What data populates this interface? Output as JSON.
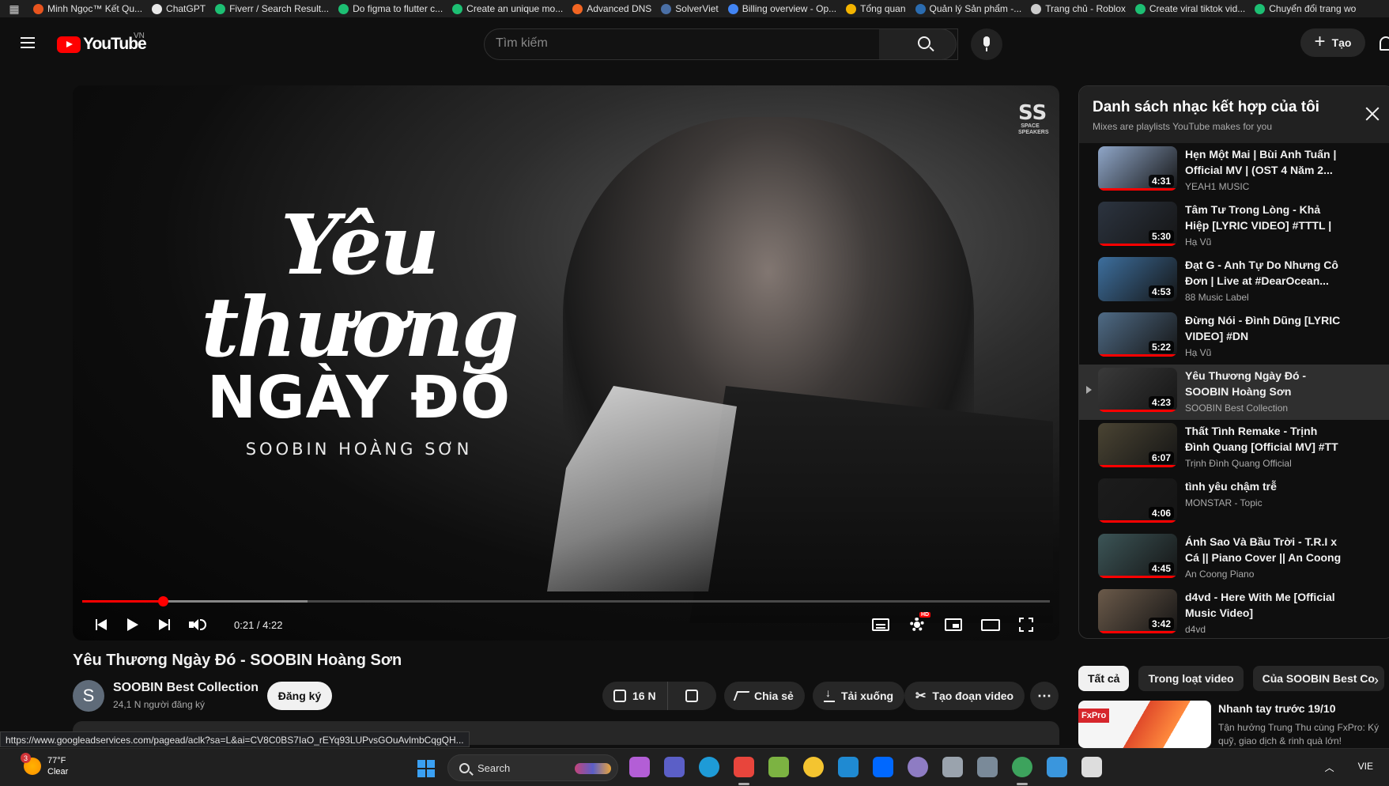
{
  "bookmarks": [
    {
      "label": "Minh Ngọc™ Kết Qu...",
      "color": "#e8541e"
    },
    {
      "label": "ChatGPT",
      "color": "#e8e8e8"
    },
    {
      "label": "Fiverr / Search Result...",
      "color": "#1dbf73"
    },
    {
      "label": "Do figma to flutter c...",
      "color": "#1dbf73"
    },
    {
      "label": "Create an unique mo...",
      "color": "#1dbf73"
    },
    {
      "label": "Advanced DNS",
      "color": "#f26522"
    },
    {
      "label": "SolverViet",
      "color": "#4a6fa5"
    },
    {
      "label": "Billing overview - Op...",
      "color": "#4285f4"
    },
    {
      "label": "Tổng quan",
      "color": "#f4b400"
    },
    {
      "label": "Quản lý Sản phẩm -...",
      "color": "#2b6cb0"
    },
    {
      "label": "Trang chủ - Roblox",
      "color": "#cccccc"
    },
    {
      "label": "Create viral tiktok vid...",
      "color": "#1dbf73"
    },
    {
      "label": "Chuyển đổi trang wo",
      "color": "#1dbf73"
    }
  ],
  "header": {
    "logo_text": "YouTube",
    "region": "VN",
    "search_placeholder": "Tìm kiếm",
    "create_label": "Tạo"
  },
  "player": {
    "art_script": "Yêu thương",
    "art_caps": "NGÀY ĐÓ",
    "art_artist": "SOOBIN HOÀNG SƠN",
    "brand_mark": "SS",
    "brand_text": "SPACE SPEAKERS",
    "time": "0:21 / 4:22",
    "played_fraction": 0.083,
    "loaded_fraction": 0.233,
    "hd_badge": "HD"
  },
  "video": {
    "title": "Yêu Thương Ngày Đó - SOOBIN Hoàng Sơn",
    "channel": "SOOBIN Best Collection",
    "avatar_letter": "S",
    "subscribers": "24,1 N người đăng ký",
    "subscribe_label": "Đăng ký",
    "likes": "16 N",
    "share_label": "Chia sẻ",
    "download_label": "Tải xuống",
    "clip_label": "Tạo đoạn video"
  },
  "status_url": "https://www.googleadservices.com/pagead/aclk?sa=L&ai=CV8C0BS7IaO_rEYq93LUPvsGOuAvlmbCqgQH...",
  "mix": {
    "title": "Danh sách nhạc kết hợp của tôi",
    "subtitle": "Mixes are playlists YouTube makes for you",
    "items": [
      {
        "title": "Hẹn Một Mai | Bùi Anh Tuấn | Official MV | (OST 4 Năm 2...",
        "channel": "YEAH1 MUSIC",
        "duration": "4:31",
        "bg": "#8fa6c8",
        "watched": 1.0
      },
      {
        "title": "Tâm Tư Trong Lòng - Khả Hiệp [LYRIC VIDEO] #TTTL | Nhạc...",
        "channel": "Hạ Vũ",
        "duration": "5:30",
        "bg": "#2c3440",
        "watched": 1.0
      },
      {
        "title": "Đạt G - Anh Tự Do Nhưng Cô Đơn | Live at #DearOcean...",
        "channel": "88 Music Label",
        "duration": "4:53",
        "bg": "#3d6f9e",
        "watched": 0.0
      },
      {
        "title": "Đừng Nói - Đình Dũng [LYRIC VIDEO] #DN",
        "channel": "Hạ Vũ",
        "duration": "5:22",
        "bg": "#4f6b86",
        "watched": 1.0
      },
      {
        "title": "Yêu Thương Ngày Đó - SOOBIN Hoàng Sơn",
        "channel": "SOOBIN Best Collection",
        "duration": "4:23",
        "bg": "#3a3a3a",
        "watched": 1.0,
        "active": true
      },
      {
        "title": "Thất Tình Remake - Trịnh Đình Quang [Official MV] #TT",
        "channel": "Trịnh Đình Quang Official",
        "duration": "6:07",
        "bg": "#4a4433",
        "watched": 1.0
      },
      {
        "title": "tình yêu chậm trễ",
        "channel": "MONSTAR - Topic",
        "duration": "4:06",
        "bg": "#1c1c1c",
        "watched": 1.0
      },
      {
        "title": "Ánh Sao Và Bầu Trời - T.R.I x Cá || Piano Cover || An Coong",
        "channel": "An Coong Piano",
        "duration": "4:45",
        "bg": "#3c5557",
        "watched": 1.0
      },
      {
        "title": "d4vd - Here With Me [Official Music Video]",
        "channel": "d4vd",
        "duration": "3:42",
        "bg": "#6b5a4a",
        "watched": 1.0
      }
    ]
  },
  "chips": [
    "Tất cả",
    "Trong loạt video",
    "Của SOOBIN Best Co"
  ],
  "ad": {
    "brand": "FxPro",
    "title": "Nhanh tay trước 19/10",
    "desc": "Tận hưởng Trung Thu cùng FxPro: Ký quỹ, giao dịch & rinh quà lớn!"
  },
  "taskbar": {
    "weather_temp": "77°F",
    "weather_desc": "Clear",
    "weather_badge": "3",
    "search_label": "Search",
    "lang": "VIE",
    "icons": [
      {
        "name": "copilot-icon",
        "color": "#b35ed6"
      },
      {
        "name": "teams-icon",
        "color": "#5b5fc7"
      },
      {
        "name": "edge-icon",
        "color": "#1e9bd7"
      },
      {
        "name": "chrome-icon",
        "color": "#e8453c"
      },
      {
        "name": "chrome-canary-icon",
        "color": "#7cb342"
      },
      {
        "name": "file-explorer-icon",
        "color": "#f4c430"
      },
      {
        "name": "vscode-icon",
        "color": "#1f8ad2"
      },
      {
        "name": "zalo-icon",
        "color": "#0068ff"
      },
      {
        "name": "app-icon",
        "color": "#8e7cc3"
      },
      {
        "name": "notepad-icon",
        "color": "#9aa3ad"
      },
      {
        "name": "settings-icon",
        "color": "#7a8a99"
      },
      {
        "name": "chrome-profile-icon",
        "color": "#3da35d"
      },
      {
        "name": "notes-icon",
        "color": "#3a96dd"
      },
      {
        "name": "game-icon",
        "color": "#dddddd"
      }
    ]
  }
}
